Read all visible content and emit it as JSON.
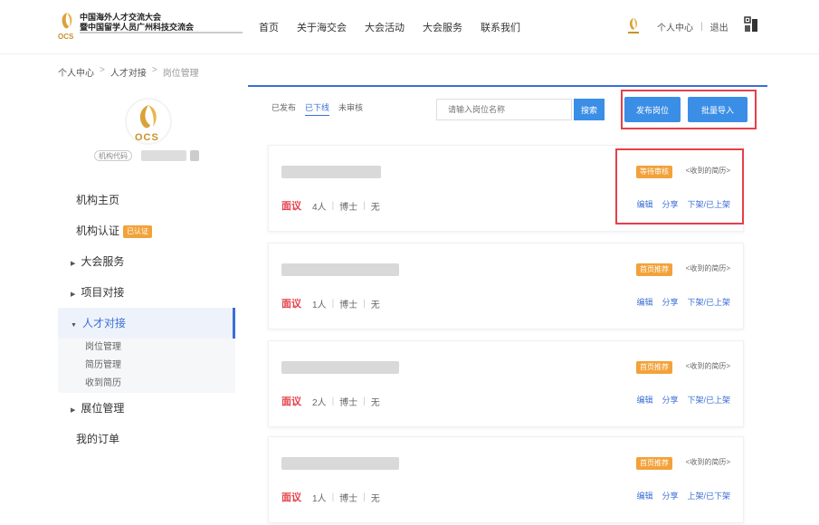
{
  "header": {
    "logo_line1": "中国海外人才交流大会",
    "logo_line2": "暨中国留学人员广州科技交流会",
    "logo_mark": "OCS",
    "nav": [
      "首页",
      "关于海交会",
      "大会活动",
      "大会服务",
      "联系我们"
    ],
    "user_center": "个人中心",
    "separator": "|",
    "logout": "退出"
  },
  "breadcrumb": {
    "items": [
      "个人中心",
      "人才对接",
      "岗位管理"
    ],
    "separator": ">"
  },
  "sidebar": {
    "org_logo": "OCS",
    "org_id_label": "机构代码",
    "menu": [
      {
        "label": "机构主页",
        "arrow": "",
        "badge": ""
      },
      {
        "label": "机构认证",
        "arrow": "",
        "badge": "已认证"
      },
      {
        "label": "大会服务",
        "arrow": "▶",
        "badge": ""
      },
      {
        "label": "项目对接",
        "arrow": "▶",
        "badge": ""
      },
      {
        "label": "人才对接",
        "arrow": "▼",
        "badge": ""
      },
      {
        "label": "展位管理",
        "arrow": "▶",
        "badge": ""
      },
      {
        "label": "我的订单",
        "arrow": "",
        "badge": ""
      }
    ],
    "submenu": [
      "岗位管理",
      "简历管理",
      "收到简历"
    ]
  },
  "main": {
    "tabs": [
      "已发布",
      "已下线",
      "未审核"
    ],
    "search_placeholder": "请输入岗位名称",
    "search_button": "搜索",
    "publish_button": "发布岗位",
    "import_button": "批量导入",
    "cards": [
      {
        "salary": "面议",
        "count": "4人",
        "degree": "博士",
        "experience": "无",
        "status": "等待审核",
        "resume": "<收到的简历>",
        "actions": [
          "编辑",
          "分享",
          "下架/已上架"
        ]
      },
      {
        "salary": "面议",
        "count": "1人",
        "degree": "博士",
        "experience": "无",
        "status": "首页推荐",
        "resume": "<收到的简历>",
        "actions": [
          "编辑",
          "分享",
          "下架/已上架"
        ]
      },
      {
        "salary": "面议",
        "count": "2人",
        "degree": "博士",
        "experience": "无",
        "status": "首页推荐",
        "resume": "<收到的简历>",
        "actions": [
          "编辑",
          "分享",
          "下架/已上架"
        ]
      },
      {
        "salary": "面议",
        "count": "1人",
        "degree": "博士",
        "experience": "无",
        "status": "首页推荐",
        "resume": "<收到的简历>",
        "actions": [
          "编辑",
          "分享",
          "上架/已下架"
        ]
      }
    ]
  }
}
